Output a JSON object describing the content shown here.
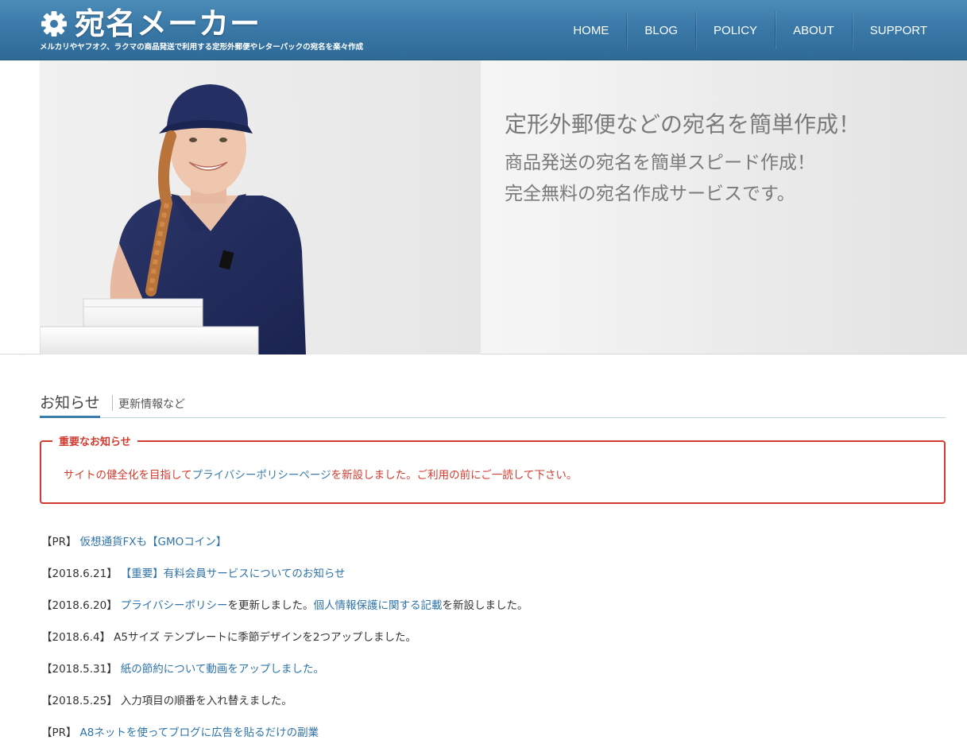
{
  "header": {
    "logo_icon": "gear-icon",
    "site_title": "宛名メーカー",
    "tagline": "メルカリやヤフオク、ラクマの商品発送で利用する定形外郵便やレターパックの宛名を楽々作成",
    "nav": [
      "HOME",
      "BLOG",
      "POLICY",
      "ABOUT",
      "SUPPORT"
    ]
  },
  "hero": {
    "headline": "定形外郵便などの宛名を簡単作成！",
    "sub_line1": "商品発送の宛名を簡単スピード作成！",
    "sub_line2": "完全無料の宛名作成サービスです。"
  },
  "notice_section": {
    "title": "お知らせ",
    "subtitle": "更新情報など",
    "important": {
      "label": "重要なお知らせ",
      "text_before": "サイトの健全化を目指して",
      "link": "プライバシーポリシーページ",
      "text_after": "を新設しました。ご利用の前にご一読して下さい。"
    },
    "items": [
      {
        "date": "【PR】",
        "link1": "仮想通貨FXも【GMOコイン】",
        "text1": "",
        "link2": "",
        "text2": ""
      },
      {
        "date": "【2018.6.21】",
        "link1": "【重要】有料会員サービスについてのお知らせ",
        "text1": "",
        "link2": "",
        "text2": ""
      },
      {
        "date": "【2018.6.20】",
        "link1": "プライバシーポリシー",
        "text1": "を更新しました。",
        "link2": "個人情報保護に関する記載",
        "text2": "を新設しました。"
      },
      {
        "date": "【2018.6.4】",
        "link1": "",
        "text1": "A5サイズ テンプレートに季節デザインを2つアップしました。",
        "link2": "",
        "text2": ""
      },
      {
        "date": "【2018.5.31】",
        "link1": "紙の節約について動画をアップしました。",
        "text1": "",
        "link2": "",
        "text2": ""
      },
      {
        "date": "【2018.5.25】",
        "link1": "",
        "text1": "入力項目の順番を入れ替えました。",
        "link2": "",
        "text2": ""
      },
      {
        "date": "【PR】",
        "link1": "A8ネットを使ってブログに広告を貼るだけの副業",
        "text1": "",
        "link2": "",
        "text2": ""
      }
    ]
  },
  "colors": {
    "header_blue": "#3a79a8",
    "link_blue": "#2f74a8",
    "alert_red": "#d23b30",
    "hero_text_gray": "#7a7a7a"
  }
}
